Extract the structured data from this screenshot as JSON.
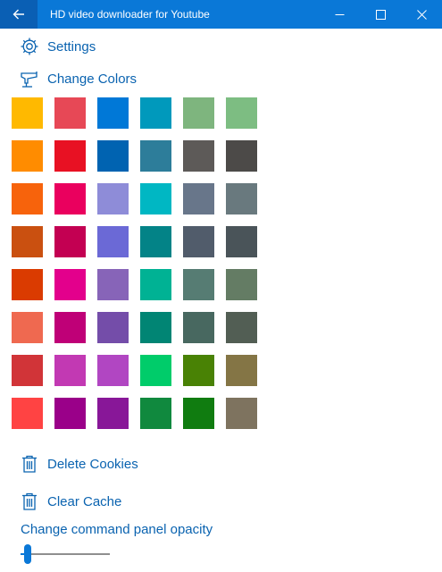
{
  "window": {
    "title": "HD video downloader for Youtube",
    "back_icon": "arrow-left-icon",
    "minimize_icon": "minimize-icon",
    "maximize_icon": "maximize-icon",
    "close_icon": "close-icon",
    "titlebar_color": "#0a78d7"
  },
  "menu": {
    "settings_label": "Settings",
    "settings_icon": "gear-icon",
    "change_colors_label": "Change Colors",
    "change_colors_icon": "paint-bucket-icon",
    "delete_cookies_label": "Delete Cookies",
    "delete_cookies_icon": "trash-icon",
    "clear_cache_label": "Clear Cache",
    "clear_cache_icon": "trash-icon",
    "accent_color": "#0a63b0"
  },
  "palette": {
    "rows": [
      [
        "#ffb900",
        "#e74856",
        "#0078d7",
        "#0099bc",
        "#7eb57e",
        "#7dbd82"
      ],
      [
        "#ff8c00",
        "#e81123",
        "#0063b1",
        "#2d7d9a",
        "#5d5a58",
        "#4c4a48"
      ],
      [
        "#f7630c",
        "#ea005e",
        "#8e8cd8",
        "#00b7c3",
        "#68768a",
        "#69797e"
      ],
      [
        "#ca5010",
        "#c30052",
        "#6b69d6",
        "#038387",
        "#515c6b",
        "#4a5459"
      ],
      [
        "#da3b01",
        "#e3008c",
        "#8764b8",
        "#00b294",
        "#567c73",
        "#647c64"
      ],
      [
        "#ef6950",
        "#bf0077",
        "#744da9",
        "#018574",
        "#486860",
        "#525e54"
      ],
      [
        "#d13438",
        "#c239b3",
        "#b146c2",
        "#00cc6a",
        "#498205",
        "#847545"
      ],
      [
        "#ff4343",
        "#9a0089",
        "#881798",
        "#10893e",
        "#107c10",
        "#7e735f"
      ]
    ]
  },
  "opacity": {
    "label": "Change command panel opacity",
    "value": 0.04
  }
}
